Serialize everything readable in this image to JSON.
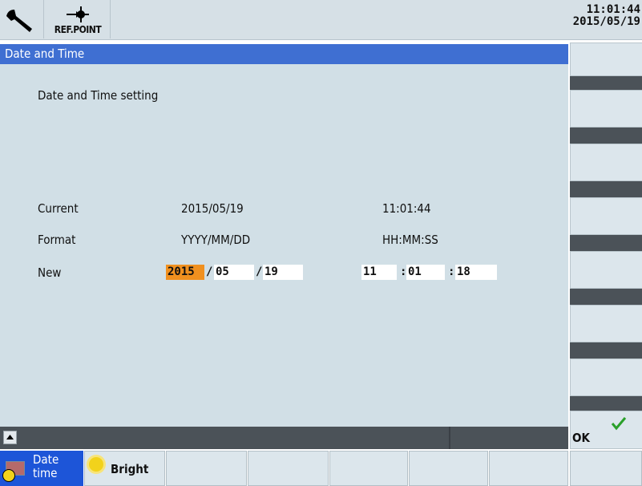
{
  "header": {
    "ref_point_label": "REF.POINT",
    "time": "11:01:44",
    "date": "2015/05/19"
  },
  "window": {
    "title": "Date and Time",
    "heading": "Date and Time setting",
    "rows": {
      "current": {
        "label": "Current",
        "date": "2015/05/19",
        "time": "11:01:44"
      },
      "format": {
        "label": "Format",
        "date": "YYYY/MM/DD",
        "time": "HH:MM:SS"
      },
      "new": {
        "label": "New",
        "year": "2015",
        "month": "05",
        "day": "19",
        "hour": "11",
        "minute": "01",
        "second": "18",
        "date_sep": "/",
        "time_sep": ":"
      }
    }
  },
  "vertical_softkeys": {
    "ok_label": "OK"
  },
  "horizontal_softkeys": {
    "date_time_line1": "Date",
    "date_time_line2": "time",
    "bright": "Bright"
  },
  "colors": {
    "title_bar": "#3f6fd2",
    "content_bg": "#d1dfe6",
    "active_softkey": "#1d55d8",
    "focus_field": "#f0901f",
    "ok_check": "#2aa02a"
  },
  "icons": {
    "wrench": "wrench-icon",
    "ref_point": "ref-point-icon",
    "scroll_up": "scroll-up-icon",
    "ok_check": "checkmark-icon",
    "date_time": "clock-icon",
    "bright": "sun-icon"
  }
}
